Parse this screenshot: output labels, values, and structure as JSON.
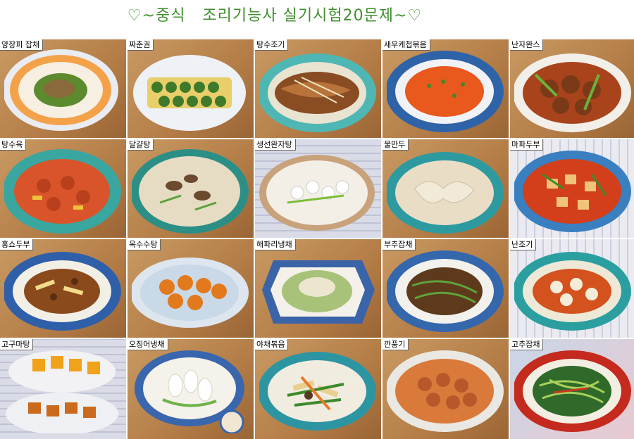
{
  "page_title": "♡~중식   조리기능사 실기시험20문제~♡",
  "dishes": [
    {
      "label": "양장피 잡채",
      "icon": "yangjangpi-japchae-photo"
    },
    {
      "label": "짜춘권",
      "icon": "jjachungwon-photo"
    },
    {
      "label": "탕수조기",
      "icon": "tangsu-jogi-photo"
    },
    {
      "label": "새우케첩볶음",
      "icon": "shrimp-ketchup-stirfry-photo"
    },
    {
      "label": "난자완스",
      "icon": "nanjawanseu-photo"
    },
    {
      "label": "탕수육",
      "icon": "tangsuyuk-photo"
    },
    {
      "label": "달걀탕",
      "icon": "egg-soup-photo"
    },
    {
      "label": "생선완자탕",
      "icon": "fish-ball-soup-photo"
    },
    {
      "label": "물만두",
      "icon": "boiled-dumpling-photo"
    },
    {
      "label": "마파두부",
      "icon": "mapo-tofu-photo"
    },
    {
      "label": "홍쇼두부",
      "icon": "hongshao-tofu-photo"
    },
    {
      "label": "옥수수탕",
      "icon": "corn-ball-photo"
    },
    {
      "label": "해파리냉채",
      "icon": "jellyfish-salad-photo"
    },
    {
      "label": "부추잡채",
      "icon": "chive-japchae-photo"
    },
    {
      "label": "난조기",
      "icon": "nanjogi-photo"
    },
    {
      "label": "고구마탕",
      "icon": "sweet-potato-candied-photo"
    },
    {
      "label": "오징어냉채",
      "icon": "squid-salad-photo"
    },
    {
      "label": "야채볶음",
      "icon": "vegetable-stirfry-photo"
    },
    {
      "label": "깐풍기",
      "icon": "kkanpunggi-photo"
    },
    {
      "label": "고추잡채",
      "icon": "pepper-japchae-photo"
    }
  ]
}
